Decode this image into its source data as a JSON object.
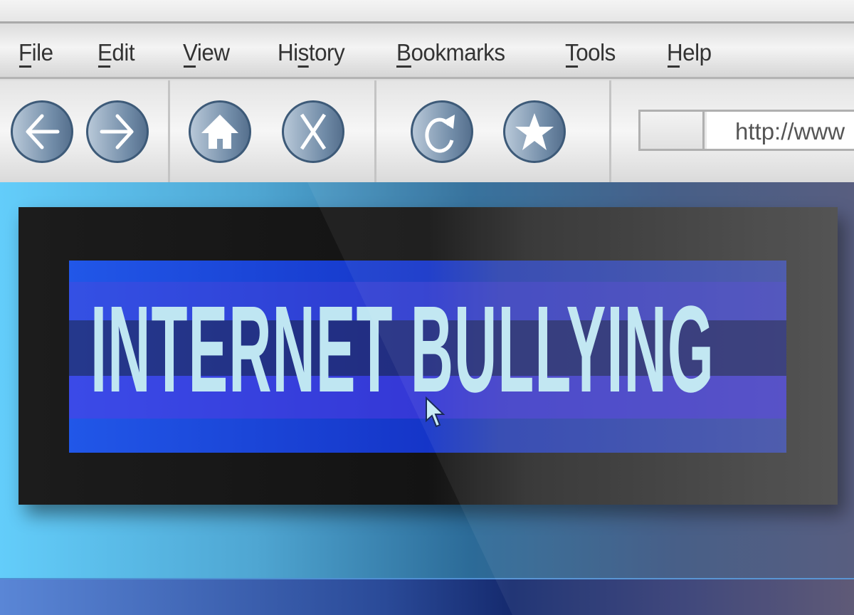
{
  "menu": {
    "items": [
      {
        "label": "File",
        "mnemonic": "F",
        "rest": "ile"
      },
      {
        "label": "Edit",
        "mnemonic": "E",
        "rest": "dit"
      },
      {
        "label": "View",
        "mnemonic": "V",
        "rest": "iew"
      },
      {
        "label": "History",
        "pre": "Hi",
        "mnemonic": "s",
        "rest": "tory"
      },
      {
        "label": "Bookmarks",
        "mnemonic": "B",
        "rest": "ookmarks"
      },
      {
        "label": "Tools",
        "mnemonic": "T",
        "rest": "ools"
      },
      {
        "label": "Help",
        "mnemonic": "H",
        "rest": "elp"
      }
    ]
  },
  "toolbar": {
    "buttons": [
      "back-arrow-icon",
      "forward-arrow-icon",
      "home-icon",
      "stop-x-icon",
      "refresh-icon",
      "star-bookmark-icon"
    ],
    "address_value": "http://www"
  },
  "page": {
    "headline": "INTERNET BULLYING"
  },
  "colors": {
    "button_fill": "#6f8aa6",
    "headline": "#bfe6f2",
    "banner": "#1f45d8",
    "panel": "#1a1a1a"
  }
}
